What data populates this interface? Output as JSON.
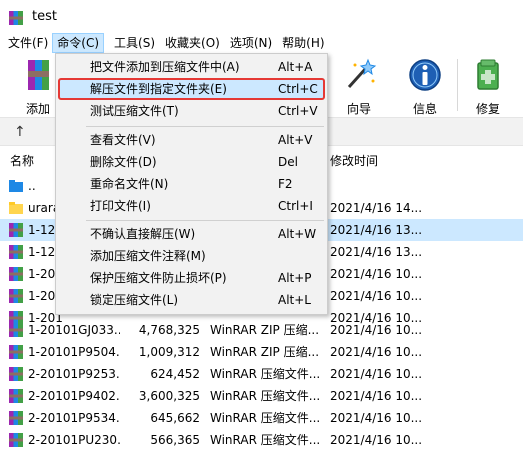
{
  "window": {
    "title": "test"
  },
  "menubar": [
    {
      "label": "文件(F)"
    },
    {
      "label": "命令(C)"
    },
    {
      "label": "工具(S)"
    },
    {
      "label": "收藏夹(O)"
    },
    {
      "label": "选项(N)"
    },
    {
      "label": "帮助(H)"
    }
  ],
  "toolbar": {
    "add_label": "添加",
    "wizard_label": "向导",
    "info_label": "信息",
    "repair_label": "修复"
  },
  "columns": {
    "name": "名称",
    "modified": "修改时间"
  },
  "menu": {
    "items": [
      {
        "label": "把文件添加到压缩文件中(A)",
        "shortcut": "Alt+A"
      },
      {
        "label": "解压文件到指定文件夹(E)",
        "shortcut": "Ctrl+C"
      },
      {
        "label": "测试压缩文件(T)",
        "shortcut": "Ctrl+V"
      },
      {
        "label": "查看文件(V)",
        "shortcut": "Alt+V"
      },
      {
        "label": "删除文件(D)",
        "shortcut": "Del"
      },
      {
        "label": "重命名文件(N)",
        "shortcut": "F2"
      },
      {
        "label": "打印文件(I)",
        "shortcut": "Ctrl+I"
      },
      {
        "label": "不确认直接解压(W)",
        "shortcut": "Alt+W"
      },
      {
        "label": "添加压缩文件注释(M)",
        "shortcut": ""
      },
      {
        "label": "保护压缩文件防止损坏(P)",
        "shortcut": "Alt+P"
      },
      {
        "label": "锁定压缩文件(L)",
        "shortcut": "Alt+L"
      }
    ]
  },
  "files": [
    {
      "name": "..",
      "size": "",
      "type": "",
      "modified": ""
    },
    {
      "name": "uraraz",
      "size": "",
      "type": "",
      "modified": "2021/4/16 14..."
    },
    {
      "name": "1-120",
      "size": "",
      "type": "",
      "modified": "2021/4/16 13..."
    },
    {
      "name": "1-120",
      "size": "",
      "type": "",
      "modified": "2021/4/16 13..."
    },
    {
      "name": "1-201",
      "size": "",
      "type": "",
      "modified": "2021/4/16 10..."
    },
    {
      "name": "1-201",
      "size": "",
      "type": "",
      "modified": "2021/4/16 10..."
    },
    {
      "name": "1-201",
      "size": "",
      "type": "",
      "modified": "2021/4/16 10..."
    },
    {
      "name": "1-20101GJ033...",
      "size": "4,768,325",
      "type": "WinRAR ZIP 压缩...",
      "modified": "2021/4/16 10..."
    },
    {
      "name": "1-20101P9504...",
      "size": "1,009,312",
      "type": "WinRAR ZIP 压缩...",
      "modified": "2021/4/16 10..."
    },
    {
      "name": "2-20101P9253...",
      "size": "624,452",
      "type": "WinRAR 压缩文件...",
      "modified": "2021/4/16 10..."
    },
    {
      "name": "2-20101P9402...",
      "size": "3,600,325",
      "type": "WinRAR 压缩文件...",
      "modified": "2021/4/16 10..."
    },
    {
      "name": "2-20101P9534...",
      "size": "645,662",
      "type": "WinRAR 压缩文件...",
      "modified": "2021/4/16 10..."
    },
    {
      "name": "2-20101PU230...",
      "size": "566,365",
      "type": "WinRAR 压缩文件...",
      "modified": "2021/4/16 10..."
    }
  ],
  "colors": {
    "accent": "#cce8ff",
    "highlight_border": "#e53935"
  }
}
